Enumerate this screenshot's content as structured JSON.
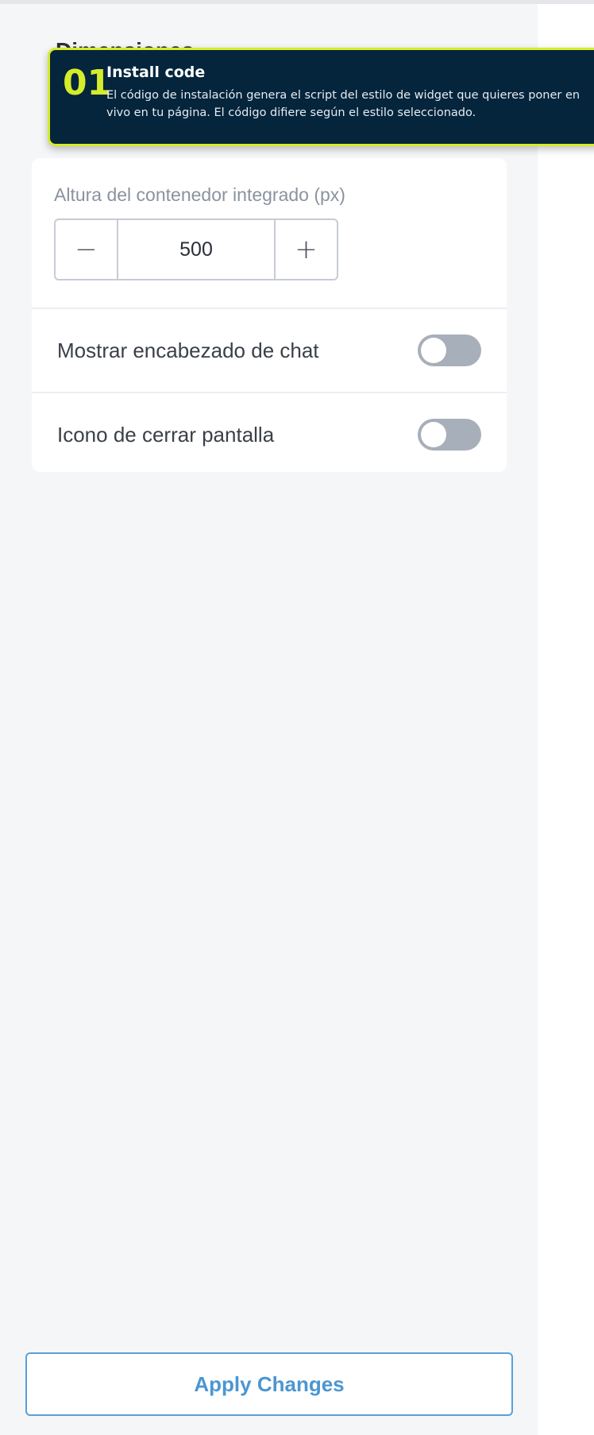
{
  "tooltip": {
    "step": "01",
    "title": "Install code",
    "body": "El código de instalación genera el script del estilo de widget que quieres poner en vivo en tu página. El código difiere según el estilo seleccionado."
  },
  "settings": {
    "height_label": "Altura del contenedor integrado (px)",
    "height_value": "500",
    "minus_symbol": "−",
    "plus_symbol": "+",
    "toggles": [
      {
        "label": "Mostrar encabezado de chat",
        "on": false
      },
      {
        "label": "Icono de cerrar pantalla",
        "on": false
      }
    ]
  },
  "footer": {
    "apply_label": "Apply Changes"
  },
  "colors": {
    "tooltip_bg": "#04253c",
    "tooltip_accent": "#d4ec2a",
    "button_text": "#4b96d1",
    "toggle_off": "#a7afbb"
  }
}
